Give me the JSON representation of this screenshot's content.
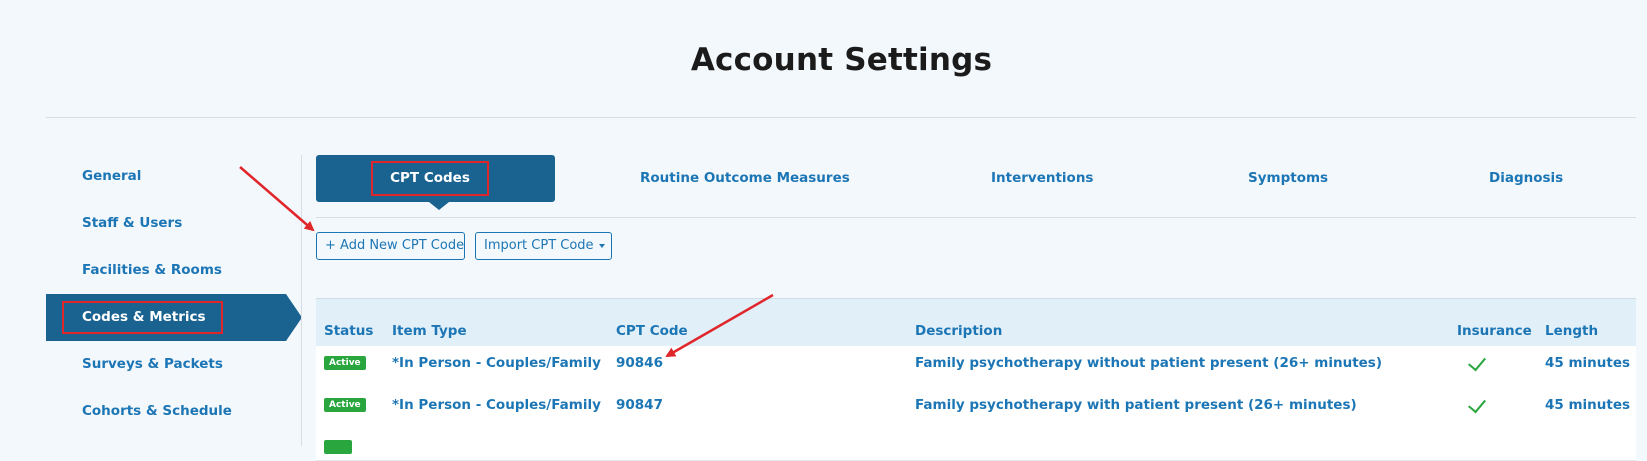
{
  "page": {
    "title": "Account Settings"
  },
  "sidebar": {
    "items": [
      {
        "label": "General"
      },
      {
        "label": "Staff & Users"
      },
      {
        "label": "Facilities & Rooms"
      },
      {
        "label": "Codes & Metrics",
        "active": true
      },
      {
        "label": "Surveys & Packets"
      },
      {
        "label": "Cohorts & Schedule"
      }
    ]
  },
  "tabs": [
    {
      "label": "CPT Codes",
      "active": true
    },
    {
      "label": "Routine Outcome Measures"
    },
    {
      "label": "Interventions"
    },
    {
      "label": "Symptoms"
    },
    {
      "label": "Diagnosis"
    }
  ],
  "actions": {
    "add_label": "+ Add New CPT Code",
    "import_label": "Import CPT Code"
  },
  "table": {
    "columns": [
      "Status",
      "Item Type",
      "CPT Code",
      "Description",
      "Insurance",
      "Length"
    ],
    "rows": [
      {
        "status": "Active",
        "item_type": "*In Person - Couples/Family",
        "cpt_code": "90846",
        "description": "Family psychotherapy without patient present (26+ minutes)",
        "insurance": "check-icon",
        "length": "45 minutes"
      },
      {
        "status": "Active",
        "item_type": "*In Person - Couples/Family",
        "cpt_code": "90847",
        "description": "Family psychotherapy with patient present (26+ minutes)",
        "insurance": "check-icon",
        "length": "45 minutes"
      }
    ]
  },
  "colors": {
    "primary": "#1a6391",
    "link": "#1c76b5",
    "active_badge": "#2aa63f",
    "highlight": "#e0262b"
  }
}
